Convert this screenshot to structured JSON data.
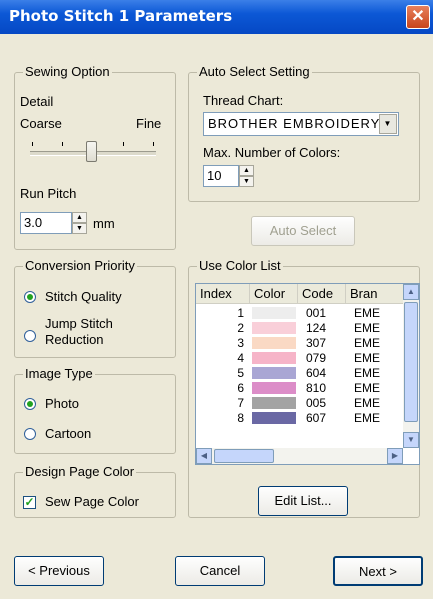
{
  "window": {
    "title": "Photo Stitch 1 Parameters",
    "close_glyph": "✕"
  },
  "sewing_option": {
    "legend": "Sewing Option",
    "detail_label": "Detail",
    "coarse_label": "Coarse",
    "fine_label": "Fine",
    "detail_level": 0.5,
    "run_pitch_label": "Run Pitch",
    "run_pitch_value": "3.0",
    "unit": "mm"
  },
  "auto_select": {
    "legend": "Auto Select Setting",
    "thread_chart_label": "Thread Chart:",
    "thread_chart_value": "BROTHER EMBROIDERY",
    "max_colors_label": "Max. Number of Colors:",
    "max_colors_value": "10",
    "auto_select_button": "Auto Select"
  },
  "conversion_priority": {
    "legend": "Conversion Priority",
    "options": [
      {
        "label": "Stitch Quality",
        "selected": true
      },
      {
        "label_line1": "Jump Stitch",
        "label_line2": "Reduction",
        "selected": false
      }
    ]
  },
  "image_type": {
    "legend": "Image Type",
    "options": [
      {
        "label": "Photo",
        "selected": true
      },
      {
        "label": "Cartoon",
        "selected": false
      }
    ]
  },
  "design_page_color": {
    "legend": "Design Page Color",
    "checkbox_label": "Sew Page Color",
    "checked": true
  },
  "color_list": {
    "legend": "Use Color List",
    "columns": [
      "Index",
      "Color",
      "Code",
      "Bran"
    ],
    "rows": [
      {
        "index": "1",
        "color": "#ededed",
        "code": "001",
        "brand": "EME"
      },
      {
        "index": "2",
        "color": "#f9cfd9",
        "code": "124",
        "brand": "EME"
      },
      {
        "index": "3",
        "color": "#fad9c4",
        "code": "307",
        "brand": "EME"
      },
      {
        "index": "4",
        "color": "#f6b4c8",
        "code": "079",
        "brand": "EME"
      },
      {
        "index": "5",
        "color": "#a9a6d4",
        "code": "604",
        "brand": "EME"
      },
      {
        "index": "6",
        "color": "#dc8dc8",
        "code": "810",
        "brand": "EME"
      },
      {
        "index": "7",
        "color": "#a3a3a3",
        "code": "005",
        "brand": "EME"
      },
      {
        "index": "8",
        "color": "#6a68a4",
        "code": "607",
        "brand": "EME"
      }
    ],
    "edit_button": "Edit List..."
  },
  "footer": {
    "previous": "< Previous",
    "cancel": "Cancel",
    "next": "Next >"
  }
}
